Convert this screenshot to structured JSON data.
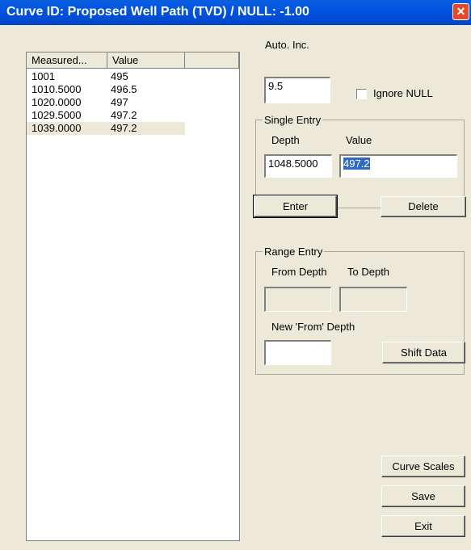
{
  "window": {
    "title": "Curve ID: Proposed Well Path (TVD) / NULL: -1.00",
    "close_glyph": "✕"
  },
  "list": {
    "columns": [
      "Measured...",
      "Value",
      ""
    ],
    "rows": [
      {
        "depth": "1001",
        "value": "495"
      },
      {
        "depth": "1010.5000",
        "value": "496.5"
      },
      {
        "depth": "1020.0000",
        "value": "497"
      },
      {
        "depth": "1029.5000",
        "value": "497.2"
      },
      {
        "depth": "1039.0000",
        "value": "497.2"
      }
    ],
    "selected_index": 4
  },
  "auto_inc": {
    "label": "Auto. Inc.",
    "value": "9.5"
  },
  "ignore_null": {
    "label": "Ignore NULL",
    "checked": false
  },
  "single_entry": {
    "legend": "Single Entry",
    "depth_label": "Depth",
    "value_label": "Value",
    "depth_value": "1048.5000",
    "value_value": "497.2"
  },
  "buttons": {
    "enter": "Enter",
    "delete": "Delete",
    "shift_data": "Shift Data",
    "curve_scales": "Curve Scales",
    "save": "Save",
    "exit": "Exit"
  },
  "range_entry": {
    "legend": "Range Entry",
    "from_label": "From Depth",
    "to_label": "To Depth",
    "new_from_label": "New 'From' Depth",
    "from_value": "",
    "to_value": "",
    "new_from_value": ""
  },
  "colors": {
    "titlebar": "#0054e3",
    "face": "#ece9d8",
    "selection": "#316ac5",
    "close": "#e24a2a"
  }
}
